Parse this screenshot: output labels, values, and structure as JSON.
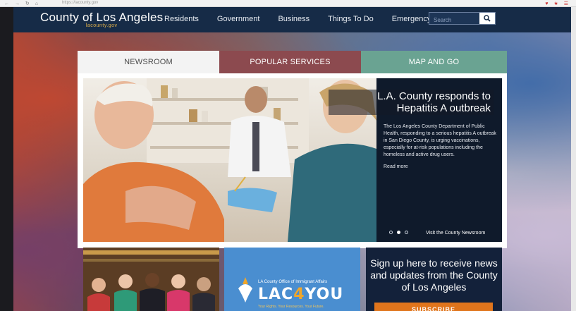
{
  "browser": {
    "nav_glyphs": "← → ↻ ⌂",
    "url": "https://lacounty.gov",
    "right_glyphs": "♥ ★ ☰"
  },
  "header": {
    "logo_name": "County of Los Angeles",
    "logo_sub": "lacounty.gov",
    "nav": [
      "Residents",
      "Government",
      "Business",
      "Things To Do",
      "Emergency"
    ],
    "search_placeholder": "Search",
    "colors": {
      "bar": "#162b47",
      "logo_accent": "#e3b24a"
    }
  },
  "tabs": [
    {
      "label": "NEWSROOM",
      "color": "#f3f3f3",
      "active": true
    },
    {
      "label": "POPULAR SERVICES",
      "color": "#8c4a4f",
      "active": false
    },
    {
      "label": "MAP AND GO",
      "color": "#6aa392",
      "active": false
    }
  ],
  "slide": {
    "title": "L.A. County responds to Hepatitis A outbreak",
    "body": "The Los Angeles County Department of Public Health, responding to a serious hepatitis A outbreak in San Diego County, is urging vaccinations, especially for at-risk populations including the homeless and active drug users.",
    "read_more": "Read more",
    "current_slide": 2,
    "total_slides": 3,
    "newsroom_link": "Visit the County Newsroom"
  },
  "cards": {
    "immigrant_office": "LA County Office of Immigrant Affairs",
    "lac_part1": "LAC",
    "lac_part2": "4",
    "lac_part3": "YOU",
    "lac_tagline": "Your Rights. Your Resources. Your Future.",
    "signup_text": "Sign up here to receive news and updates from the County of Los Angeles",
    "subscribe_label": "SUBSCRIBE",
    "colors": {
      "subscribe": "#e0751c",
      "lac_card": "#4a8ed0"
    }
  }
}
